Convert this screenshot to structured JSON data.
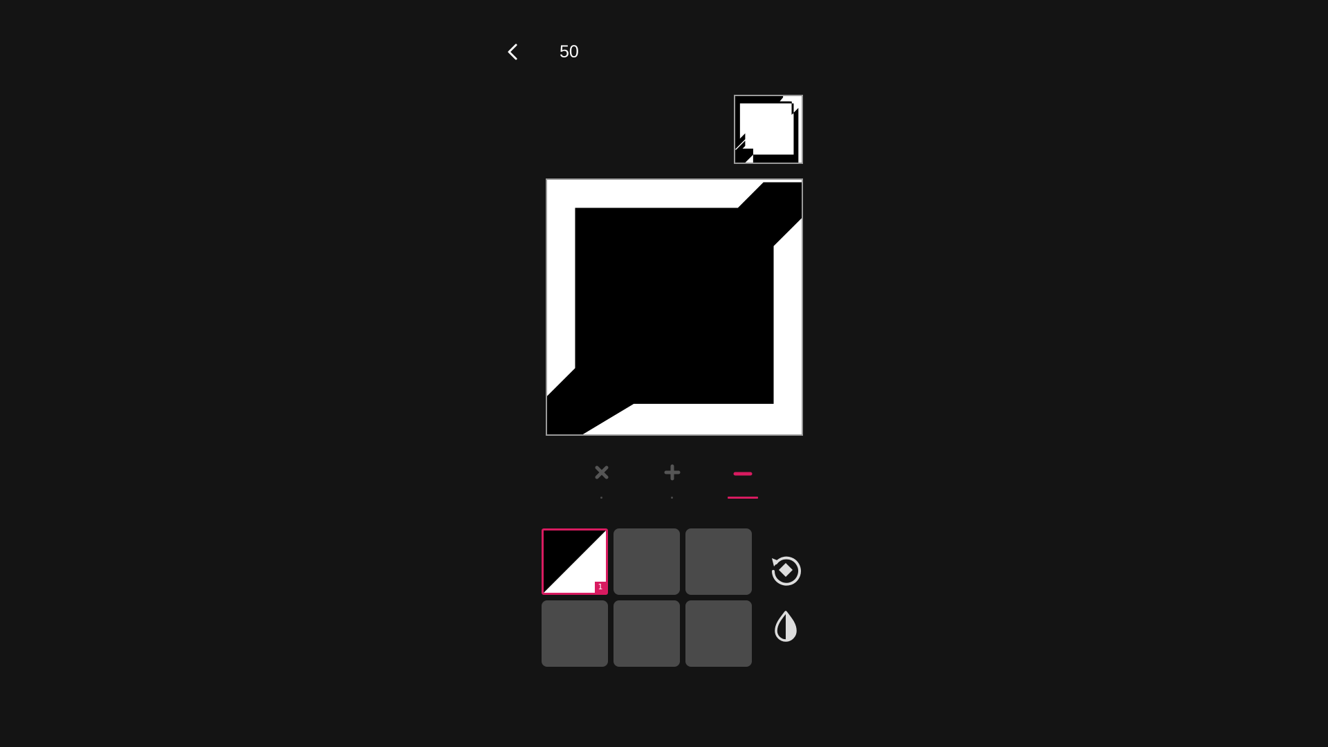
{
  "header": {
    "back_icon": "chevron-left-icon",
    "level": "50"
  },
  "operations": [
    {
      "name": "multiply",
      "symbol": "×",
      "active": false
    },
    {
      "name": "add",
      "symbol": "+",
      "active": false
    },
    {
      "name": "subtract",
      "symbol": "−",
      "active": true
    }
  ],
  "tiles": [
    {
      "filled": true,
      "pattern": "diagonal-black-top-left",
      "count": "1",
      "selected": true
    },
    {
      "filled": false
    },
    {
      "filled": false
    },
    {
      "filled": false
    },
    {
      "filled": false
    },
    {
      "filled": false
    }
  ],
  "side_buttons": [
    {
      "icon": "rotate-icon"
    },
    {
      "icon": "invert-contrast-icon"
    }
  ],
  "colors": {
    "background": "#141414",
    "accent": "#d81b60",
    "tile_empty": "#4a4a4a",
    "icon_inactive": "#555555",
    "icon_light": "#dddddd"
  }
}
